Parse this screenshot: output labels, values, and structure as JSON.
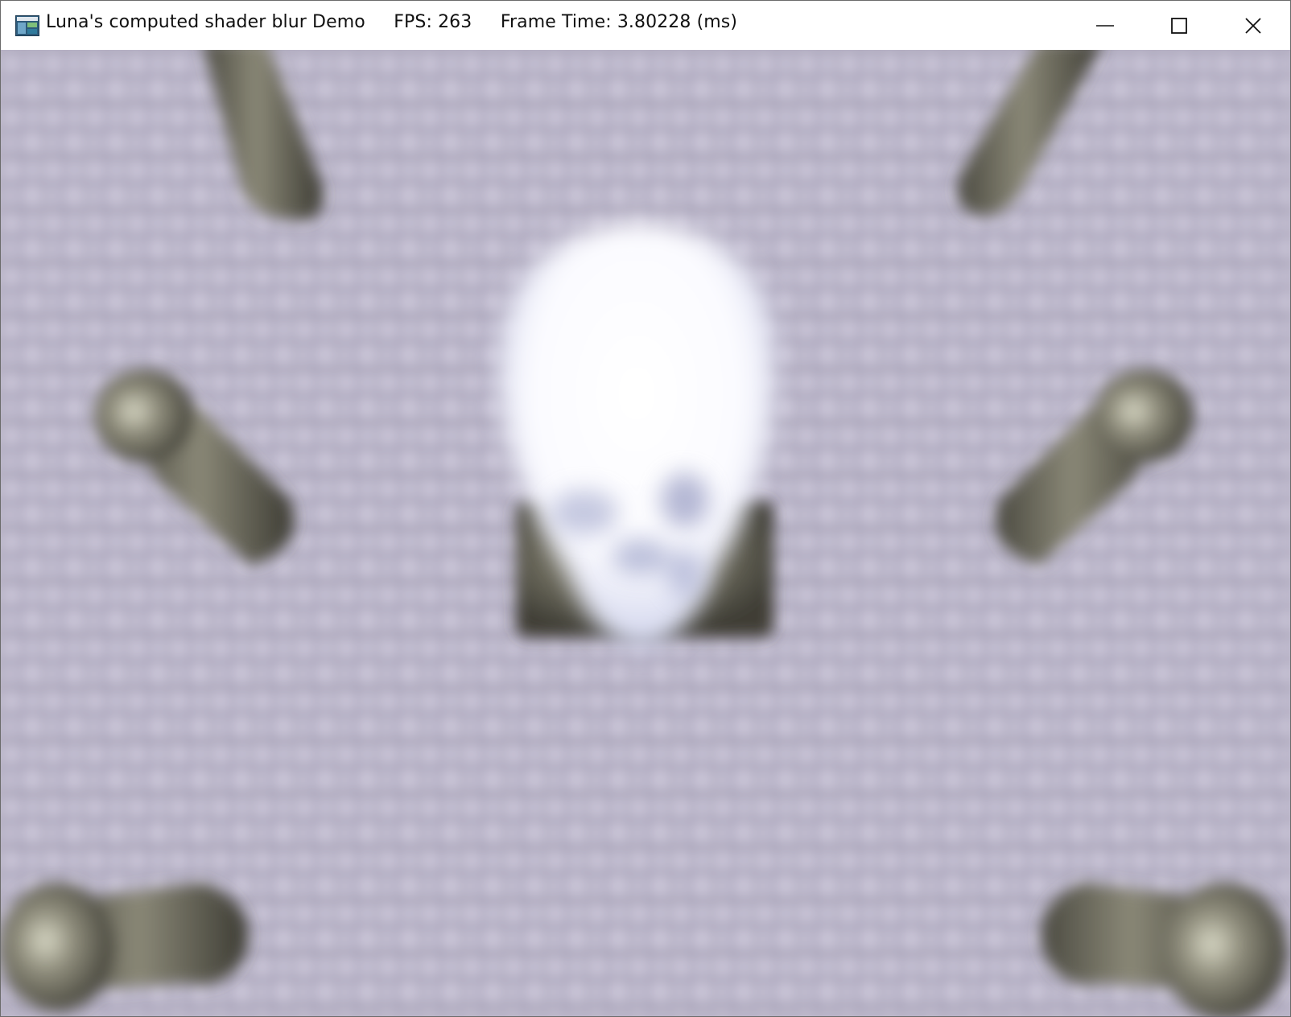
{
  "window": {
    "title": "Luna's computed shader blur Demo",
    "fps_label": "FPS: 263",
    "frame_time_label": "Frame Time: 3.80228 (ms)",
    "app_icon": "directx-app-icon"
  },
  "caption_buttons": {
    "minimize_icon": "minimize-icon",
    "maximize_icon": "maximize-icon",
    "close_icon": "close-icon"
  },
  "scene": {
    "description_objects": [
      "floor-tiles",
      "skull",
      "pillar",
      "pedestal",
      "spheres"
    ],
    "colors": {
      "floor": "#b9b4c6",
      "floor_tile_dark": "#8f8aa0",
      "floor_tile_light": "#cdc8da",
      "stone": "#6e6c5e",
      "skull": "#f6f6ff",
      "skull_shadow": "#b8bcd6"
    }
  }
}
